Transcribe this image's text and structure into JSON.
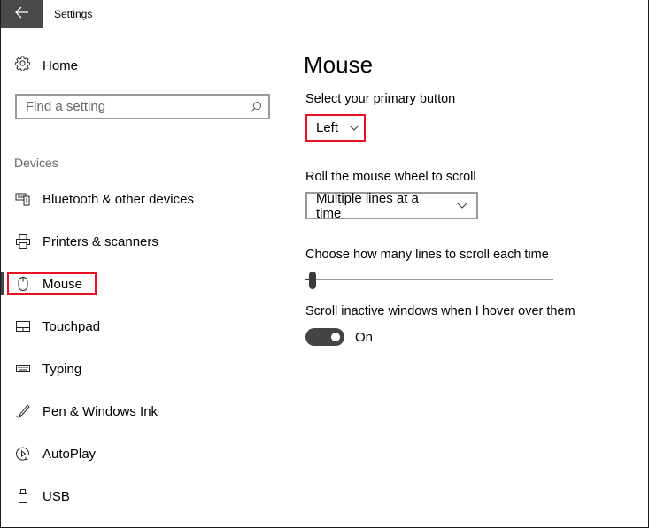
{
  "window": {
    "title": "Settings",
    "back_icon": "arrow-left-icon"
  },
  "sidebar": {
    "home": {
      "label": "Home",
      "icon": "gear-icon"
    },
    "search": {
      "placeholder": "Find a setting",
      "value": "",
      "icon": "search-icon"
    },
    "section_label": "Devices",
    "items": [
      {
        "label": "Bluetooth & other devices",
        "icon": "bluetooth-devices-icon",
        "selected": false
      },
      {
        "label": "Printers & scanners",
        "icon": "printer-icon",
        "selected": false
      },
      {
        "label": "Mouse",
        "icon": "mouse-icon",
        "selected": true
      },
      {
        "label": "Touchpad",
        "icon": "touchpad-icon",
        "selected": false
      },
      {
        "label": "Typing",
        "icon": "keyboard-icon",
        "selected": false
      },
      {
        "label": "Pen & Windows Ink",
        "icon": "pen-icon",
        "selected": false
      },
      {
        "label": "AutoPlay",
        "icon": "autoplay-icon",
        "selected": false
      },
      {
        "label": "USB",
        "icon": "usb-icon",
        "selected": false
      }
    ]
  },
  "main": {
    "title": "Mouse",
    "primary_button": {
      "label": "Select your primary button",
      "value": "Left"
    },
    "wheel_scroll": {
      "label": "Roll the mouse wheel to scroll",
      "value": "Multiple lines at a time"
    },
    "lines_to_scroll": {
      "label": "Choose how many lines to scroll each time",
      "value_fraction": 0.0
    },
    "inactive_scroll": {
      "label": "Scroll inactive windows when I hover over them",
      "state": "On",
      "enabled": true
    }
  },
  "colors": {
    "highlight": "#e81123",
    "titlebar_back": "#4b4a48",
    "toggle_on": "#444444"
  }
}
